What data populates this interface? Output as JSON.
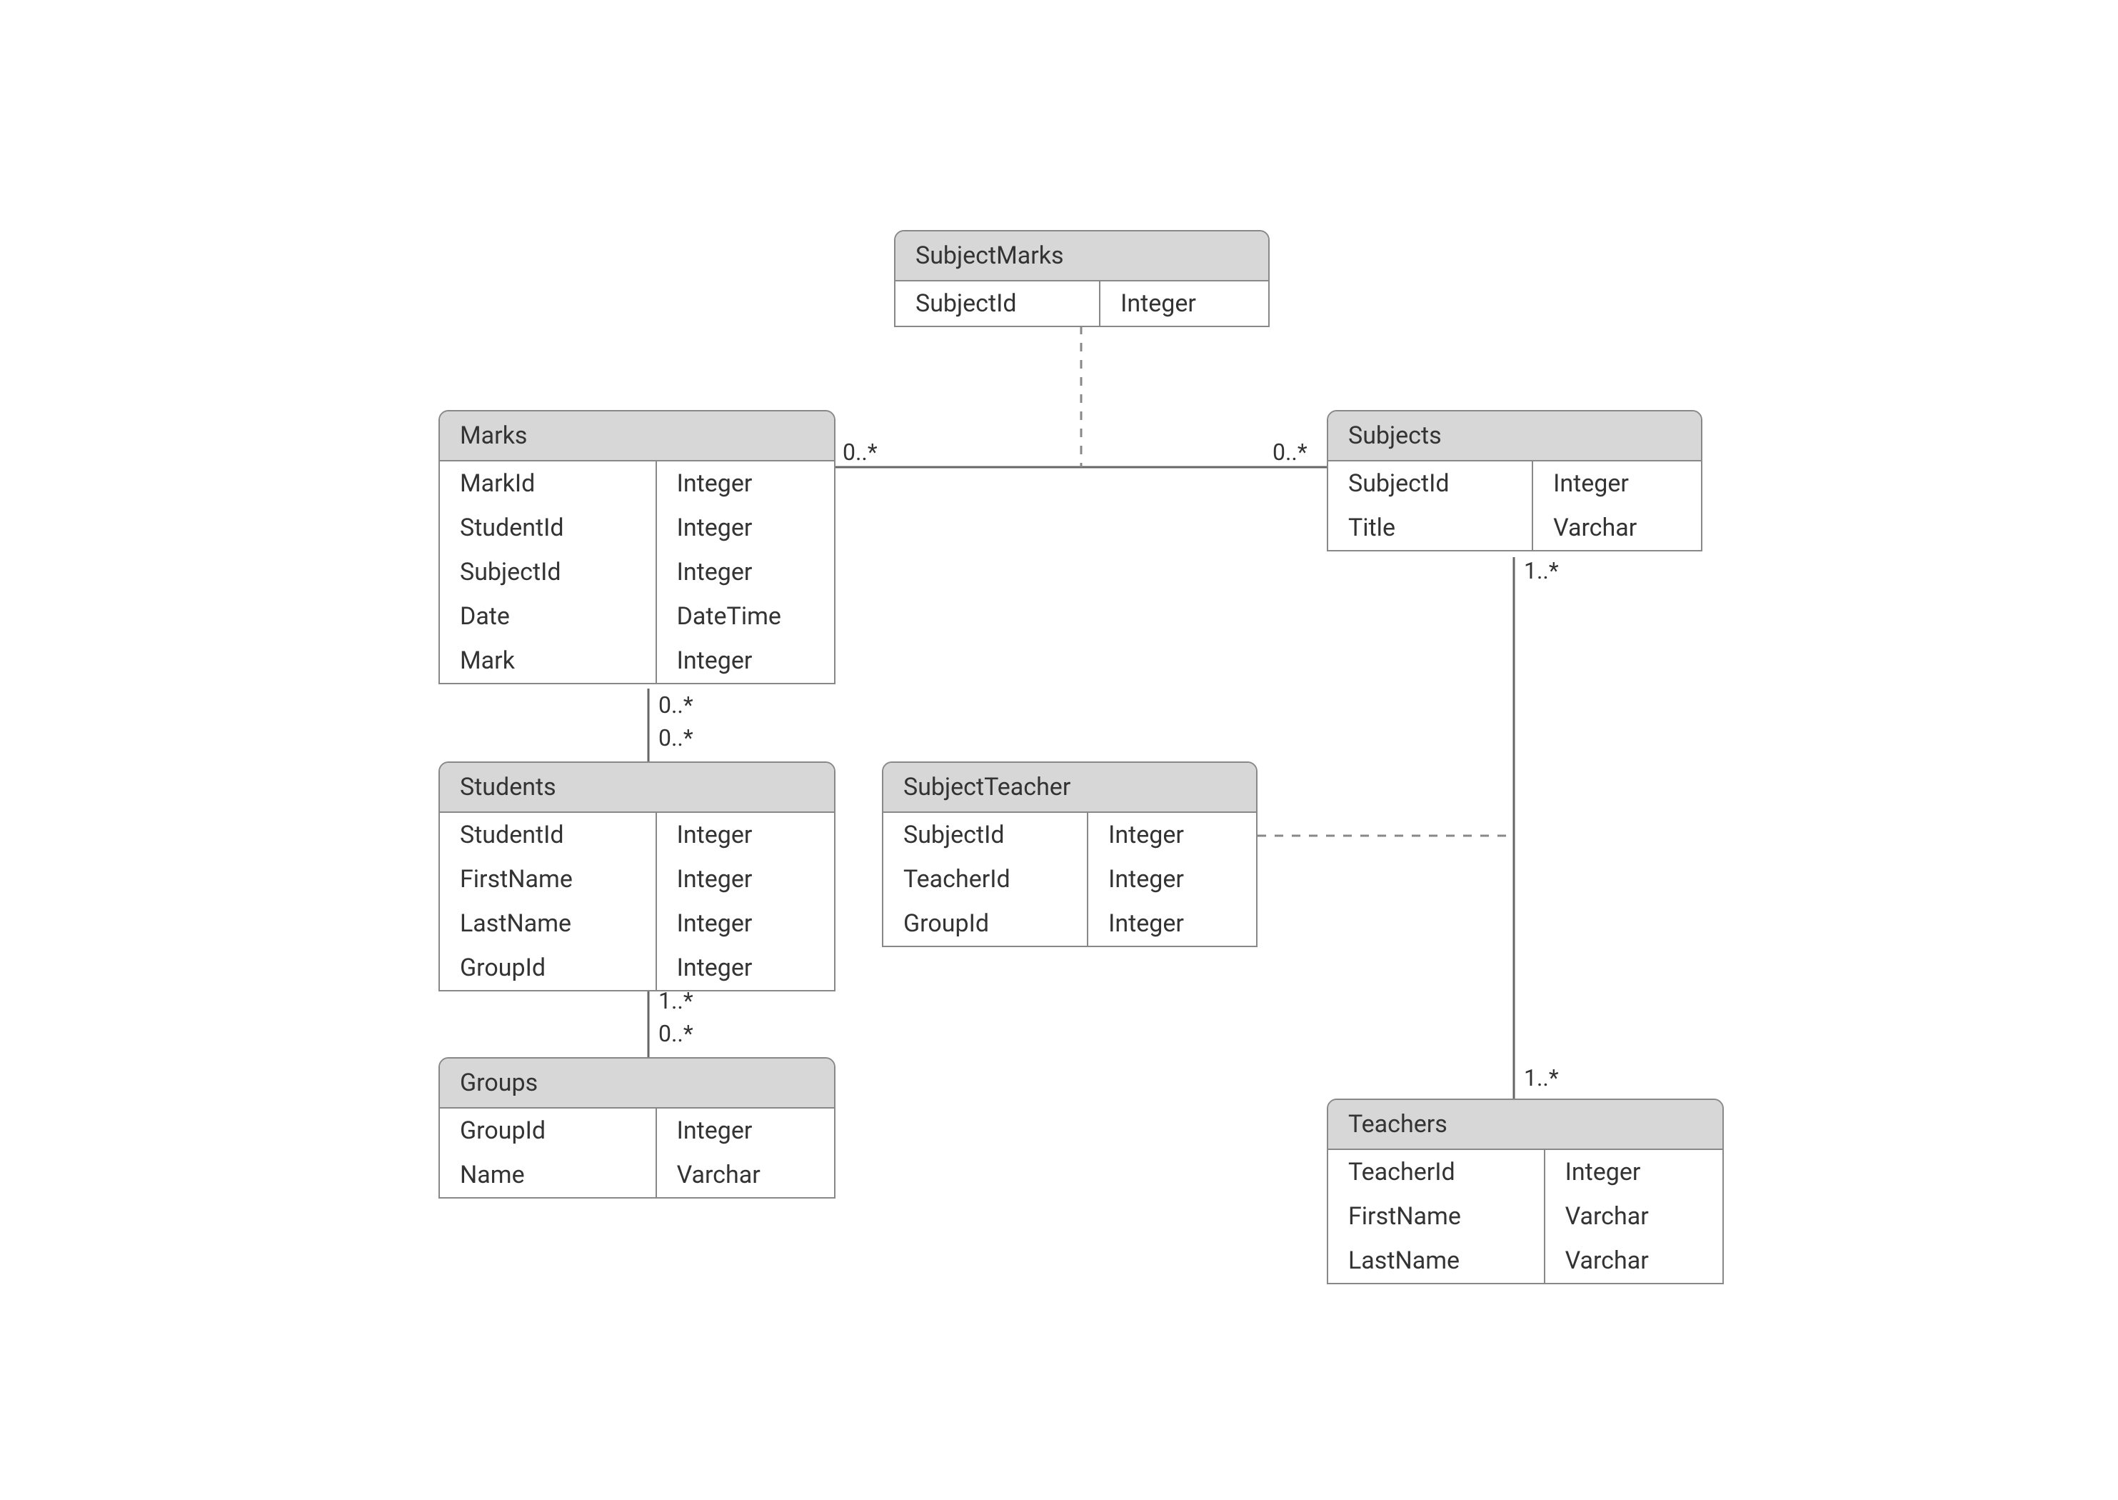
{
  "entities": {
    "subjectMarks": {
      "title": "SubjectMarks",
      "rows": [
        {
          "name": "SubjectId",
          "type": "Integer"
        }
      ]
    },
    "marks": {
      "title": "Marks",
      "rows": [
        {
          "name": "MarkId",
          "type": "Integer"
        },
        {
          "name": "StudentId",
          "type": "Integer"
        },
        {
          "name": "SubjectId",
          "type": "Integer"
        },
        {
          "name": "Date",
          "type": "DateTime"
        },
        {
          "name": "Mark",
          "type": "Integer"
        }
      ]
    },
    "subjects": {
      "title": "Subjects",
      "rows": [
        {
          "name": "SubjectId",
          "type": "Integer"
        },
        {
          "name": "Title",
          "type": "Varchar"
        }
      ]
    },
    "students": {
      "title": "Students",
      "rows": [
        {
          "name": "StudentId",
          "type": "Integer"
        },
        {
          "name": "FirstName",
          "type": "Integer"
        },
        {
          "name": "LastName",
          "type": "Integer"
        },
        {
          "name": "GroupId",
          "type": "Integer"
        }
      ]
    },
    "subjectTeacher": {
      "title": "SubjectTeacher",
      "rows": [
        {
          "name": "SubjectId",
          "type": "Integer"
        },
        {
          "name": "TeacherId",
          "type": "Integer"
        },
        {
          "name": "GroupId",
          "type": "Integer"
        }
      ]
    },
    "groups": {
      "title": "Groups",
      "rows": [
        {
          "name": "GroupId",
          "type": "Integer"
        },
        {
          "name": "Name",
          "type": "Varchar"
        }
      ]
    },
    "teachers": {
      "title": "Teachers",
      "rows": [
        {
          "name": "TeacherId",
          "type": "Integer"
        },
        {
          "name": "FirstName",
          "type": "Varchar"
        },
        {
          "name": "LastName",
          "type": "Varchar"
        }
      ]
    }
  },
  "labels": {
    "marksToSubjectsLeft": "0..*",
    "marksToSubjectsRight": "0..*",
    "subjectsBottom": "1..*",
    "marksBottom": "0..*",
    "studentsTop": "0..*",
    "studentsBottom": "1..*",
    "groupsTop": "0..*",
    "teachersTop": "1..*"
  }
}
